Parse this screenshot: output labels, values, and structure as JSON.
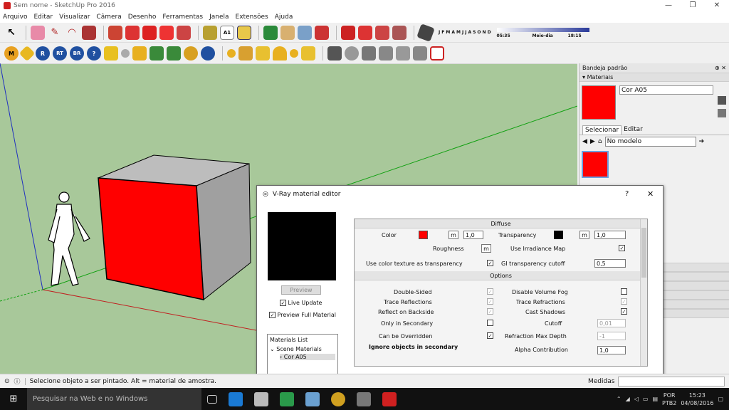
{
  "window": {
    "title": "Sem nome - SketchUp Pro 2016",
    "controls": [
      "—",
      "❐",
      "✕"
    ]
  },
  "menu": [
    "Arquivo",
    "Editar",
    "Visualizar",
    "Câmera",
    "Desenho",
    "Ferramentas",
    "Janela",
    "Extensões",
    "Ajuda"
  ],
  "toolbar2_labels": {
    "m": "M",
    "r": "R",
    "rt": "RT",
    "br": "BR",
    "q": "?"
  },
  "shadow": {
    "months": [
      "J",
      "F",
      "M",
      "A",
      "M",
      "J",
      "J",
      "A",
      "S",
      "O",
      "N",
      "D"
    ],
    "time_start": "05:35",
    "time_mid": "Meio-dia",
    "time_end": "18:15",
    "section_label": "A1"
  },
  "tray": {
    "title": "Bandeja padrão",
    "pin": "⊕",
    "close": "✕",
    "materials_title": "Materiais",
    "material_name": "Cor A05",
    "material_color": "#ff0000",
    "tabs": [
      "Selecionar",
      "Editar"
    ],
    "dropdown": "No modelo"
  },
  "vray": {
    "title": "V-Ray material editor",
    "help": "?",
    "close": "✕",
    "preview_btn": "Preview",
    "live_update": "Live Update",
    "preview_full": "Preview Full Material",
    "materials_list": "Materials List",
    "scene_materials": "Scene Materials",
    "item": "Cor A05",
    "diffuse": {
      "section": "Diffuse",
      "color": "Color",
      "m": "m",
      "color_value": "1,0",
      "transparency": "Transparency",
      "transparency_value": "1,0",
      "roughness": "Roughness",
      "use_irradiance": "Use Irradiance Map",
      "use_color_texture": "Use color texture as transparency",
      "gi_cutoff": "GI transparency cutoff",
      "gi_value": "0,5"
    },
    "options": {
      "section": "Options",
      "double_sided": "Double-Sided",
      "disable_fog": "Disable Volume Fog",
      "trace_reflections": "Trace Reflections",
      "trace_refractions": "Trace Refractions",
      "reflect_backside": "Reflect on Backside",
      "cast_shadows": "Cast Shadows",
      "only_secondary": "Only in Secondary",
      "cutoff": "Cutoff",
      "cutoff_value": "0,01",
      "can_override": "Can be Overridden",
      "refraction_max_depth": "Refraction Max Depth",
      "refraction_value": "-1",
      "ignore_secondary": "Ignore objects in secondary",
      "alpha_contribution": "Alpha Contribution",
      "alpha_value": "1,0"
    }
  },
  "status": {
    "text": "Selecione objeto a ser pintado. Alt = material de amostra.",
    "measures": "Medidas"
  },
  "taskbar": {
    "search": "Pesquisar na Web e no Windows",
    "lang": "POR",
    "layout": "PTB2",
    "time": "15:23",
    "date": "04/08/2016"
  }
}
